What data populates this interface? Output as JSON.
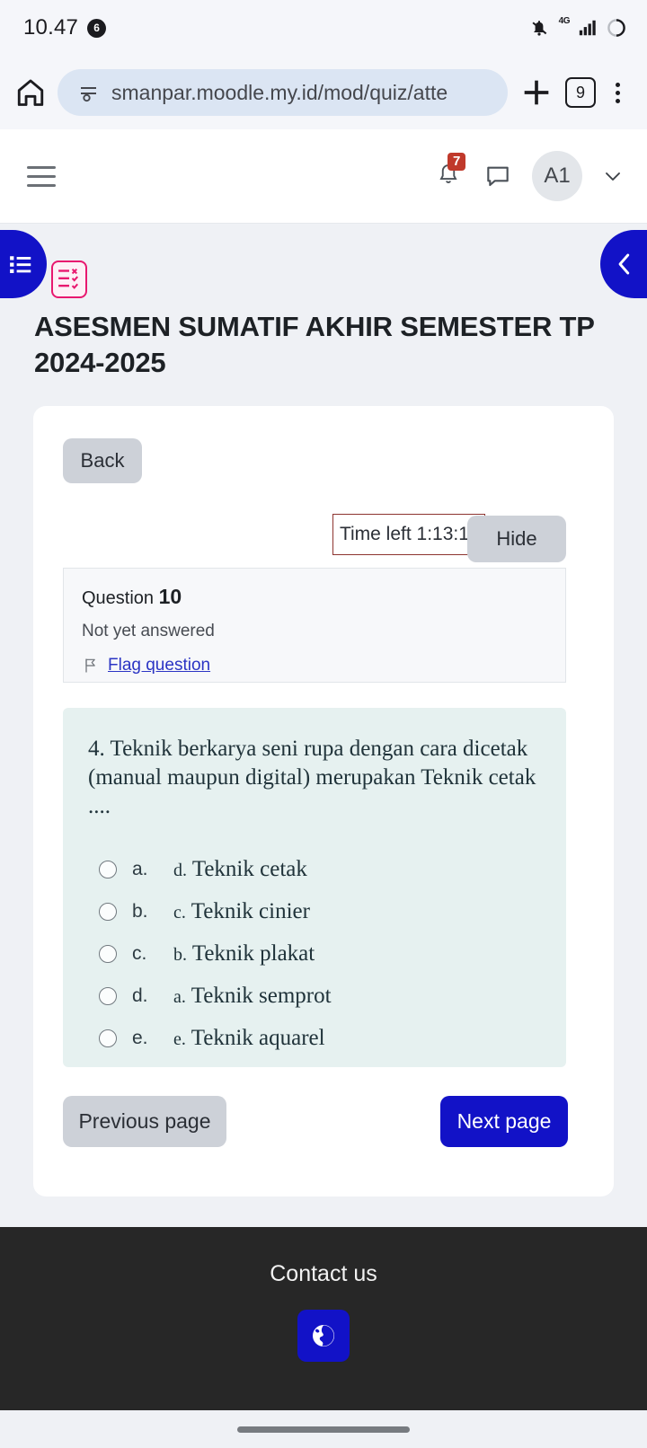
{
  "status_bar": {
    "time": "10.47",
    "notification_count": "6",
    "network_label": "4G",
    "icons": [
      "vibrate-off-icon",
      "signal-icon",
      "battery-icon"
    ]
  },
  "browser": {
    "home_icon": "home-icon",
    "site_info_icon": "site-settings-icon",
    "url": "smanpar.moodle.my.id/mod/quiz/atte",
    "new_tab_icon": "plus-icon",
    "tab_count": "9",
    "menu_icon": "kebab-menu-icon"
  },
  "moodle_header": {
    "menu_icon": "hamburger-icon",
    "notification_badge": "7",
    "bell_icon": "bell-icon",
    "message_icon": "message-icon",
    "avatar_initials": "A1",
    "chevron_icon": "chevron-down-icon"
  },
  "drawers": {
    "left_icon": "course-index-list-icon",
    "right_icon": "chevron-left-icon",
    "activity_icon": "quiz-activity-icon"
  },
  "page": {
    "title": "ASESMEN SUMATIF AKHIR SEMESTER TP 2024-2025"
  },
  "quiz": {
    "back_label": "Back",
    "timer_label": "Time left 1:13:11",
    "hide_label": "Hide",
    "question_label": "Question",
    "question_number": "10",
    "status": "Not yet answered",
    "flag_icon": "flag-icon",
    "flag_label": "Flag question",
    "question_text": "4. Teknik berkarya seni rupa dengan cara dicetak (manual maupun digital) merupakan Teknik cetak ....",
    "options": [
      {
        "key": "a.",
        "prefix": "d.",
        "text": "Teknik cetak",
        "selected": false
      },
      {
        "key": "b.",
        "prefix": "c.",
        "text": "Teknik cinier",
        "selected": false
      },
      {
        "key": "c.",
        "prefix": "b.",
        "text": "Teknik plakat",
        "selected": false
      },
      {
        "key": "d.",
        "prefix": "a.",
        "text": "Teknik semprot",
        "selected": false
      },
      {
        "key": "e.",
        "prefix": "e.",
        "text": "Teknik aquarel",
        "selected": false
      }
    ],
    "previous_label": "Previous page",
    "next_label": "Next page"
  },
  "footer": {
    "title": "Contact us",
    "globe_icon": "globe-icon"
  },
  "colors": {
    "brand_blue": "#1212c7",
    "badge_red": "#c0392b",
    "timer_border": "#8d3430",
    "question_bg": "#e6f1f0",
    "page_bg": "#eff1f5",
    "footer_bg": "#272727",
    "accent_pink": "#e8186f"
  }
}
